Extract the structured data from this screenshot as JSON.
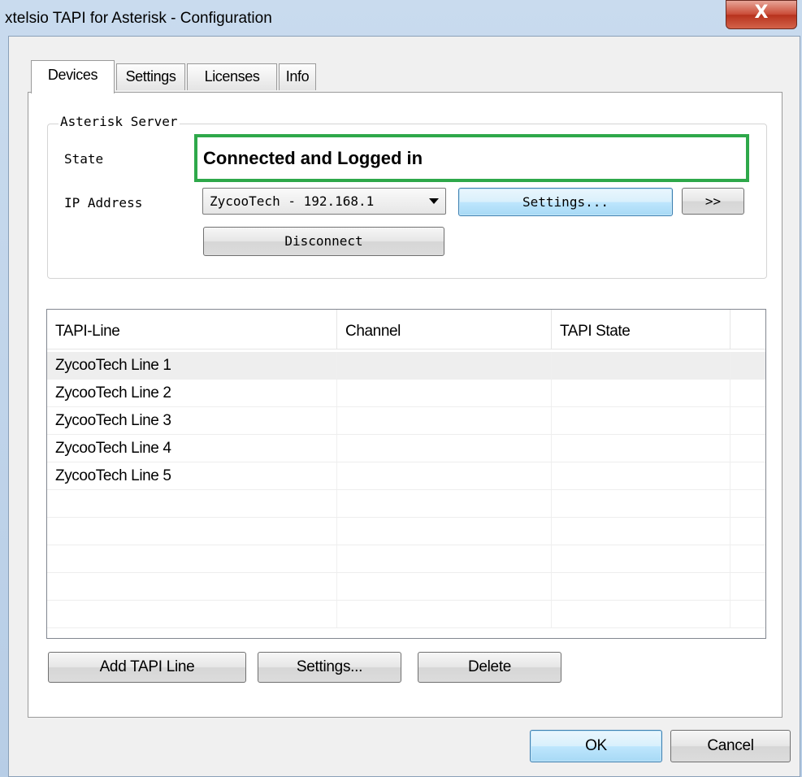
{
  "window": {
    "title": "xtelsio TAPI for Asterisk - Configuration",
    "close_glyph": "X"
  },
  "tabs": [
    {
      "label": "Devices",
      "active": true
    },
    {
      "label": "Settings",
      "active": false
    },
    {
      "label": "Licenses",
      "active": false
    },
    {
      "label": "Info",
      "active": false
    }
  ],
  "server_group": {
    "legend": "Asterisk Server",
    "state_label": "State",
    "state_value": "Connected and Logged in",
    "ip_label": "IP Address",
    "ip_selected": "ZycooTech - 192.168.1",
    "settings_button": "Settings...",
    "more_button": ">>",
    "disconnect_button": "Disconnect"
  },
  "lines_table": {
    "columns": [
      "TAPI-Line",
      "Channel",
      "TAPI State"
    ],
    "rows": [
      {
        "line": "ZycooTech Line 1",
        "channel": "",
        "state": ""
      },
      {
        "line": "ZycooTech Line 2",
        "channel": "",
        "state": ""
      },
      {
        "line": "ZycooTech Line 3",
        "channel": "",
        "state": ""
      },
      {
        "line": "ZycooTech Line 4",
        "channel": "",
        "state": ""
      },
      {
        "line": "ZycooTech Line 5",
        "channel": "",
        "state": ""
      }
    ]
  },
  "line_buttons": {
    "add": "Add TAPI Line",
    "settings": "Settings...",
    "delete": "Delete"
  },
  "dialog_buttons": {
    "ok": "OK",
    "cancel": "Cancel"
  },
  "colors": {
    "state_highlight": "#2ea84a",
    "focus_button": "#a7d9f5"
  }
}
